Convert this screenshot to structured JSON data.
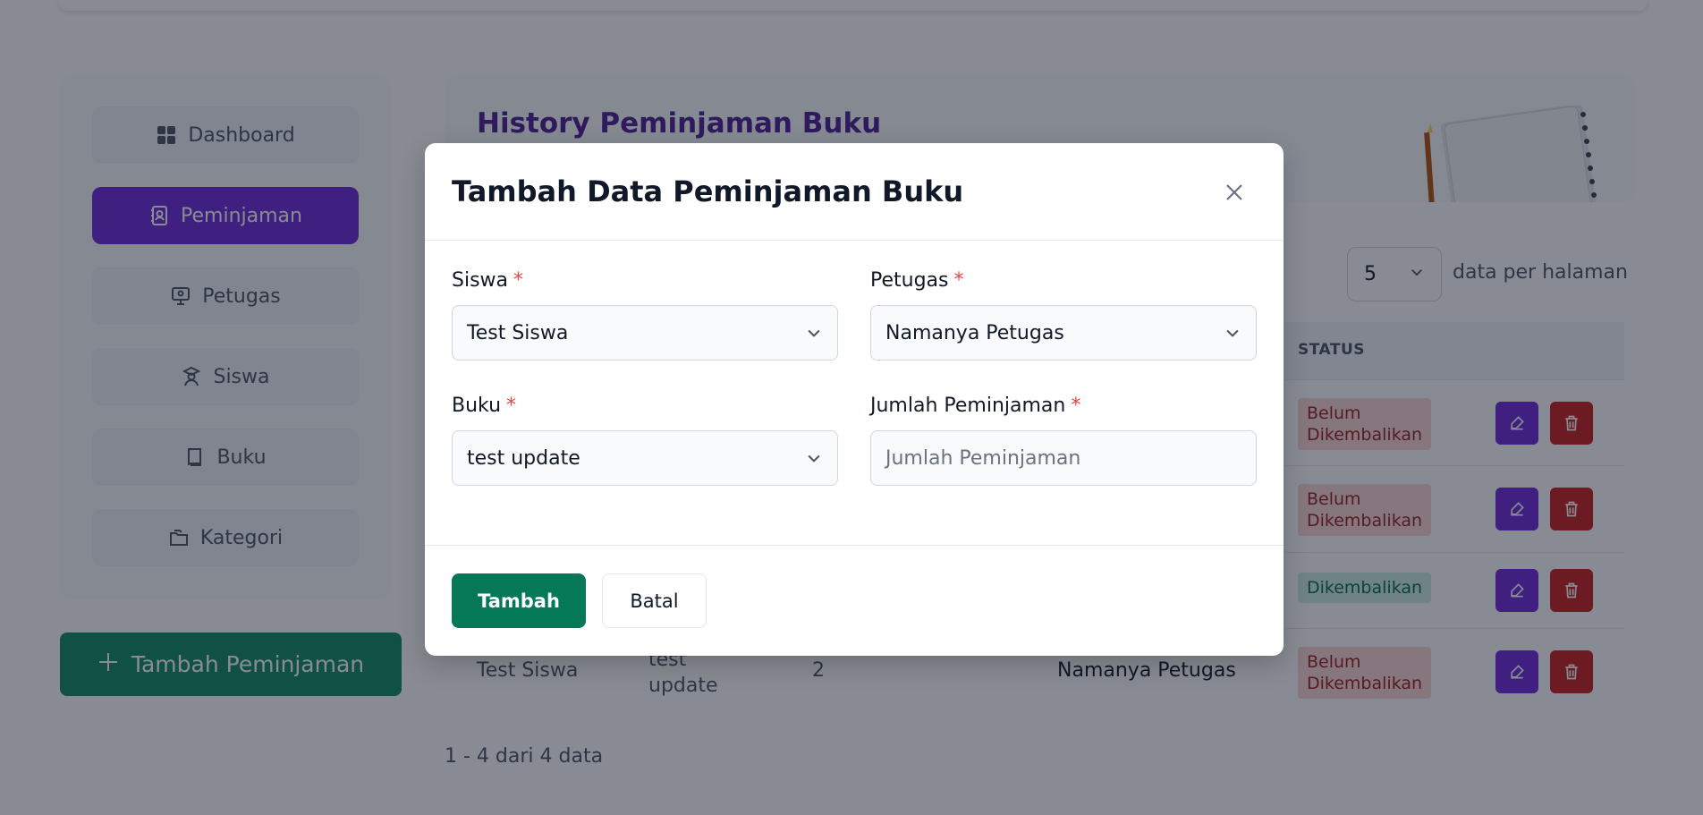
{
  "sidebar": {
    "items": [
      {
        "label": "Dashboard",
        "icon": "dashboard-icon"
      },
      {
        "label": "Peminjaman",
        "icon": "peminjaman-icon",
        "active": true
      },
      {
        "label": "Petugas",
        "icon": "petugas-icon"
      },
      {
        "label": "Siswa",
        "icon": "siswa-icon"
      },
      {
        "label": "Buku",
        "icon": "book-icon"
      },
      {
        "label": "Kategori",
        "icon": "kategori-icon"
      }
    ],
    "add_button_label": "Tambah Peminjaman"
  },
  "header": {
    "title": "History Peminjaman Buku"
  },
  "toolbar": {
    "per_page_value": "5",
    "per_page_label": "data per halaman"
  },
  "table": {
    "status_header": "STATUS",
    "rows": [
      {
        "status": "Belum Dikembalikan"
      },
      {
        "status": "Belum Dikembalikan"
      },
      {
        "status": "Dikembalikan"
      },
      {
        "siswa": "Test Siswa",
        "buku": "test update",
        "jumlah": "2",
        "petugas": "Namanya Petugas",
        "status": "Belum Dikembalikan"
      }
    ],
    "pagination_info": "1 - 4 dari 4 data"
  },
  "modal": {
    "title": "Tambah Data Peminjaman Buku",
    "fields": {
      "siswa": {
        "label": "Siswa",
        "value": "Test Siswa"
      },
      "petugas": {
        "label": "Petugas",
        "value": "Namanya Petugas"
      },
      "buku": {
        "label": "Buku",
        "value": "test update"
      },
      "jumlah": {
        "label": "Jumlah Peminjaman",
        "placeholder": "Jumlah Peminjaman"
      }
    },
    "required_marker": "*",
    "submit_label": "Tambah",
    "cancel_label": "Batal"
  },
  "colors": {
    "primary": "#6d28d9",
    "success": "#047857",
    "danger": "#c81e1e",
    "title": "#4c1d95"
  }
}
